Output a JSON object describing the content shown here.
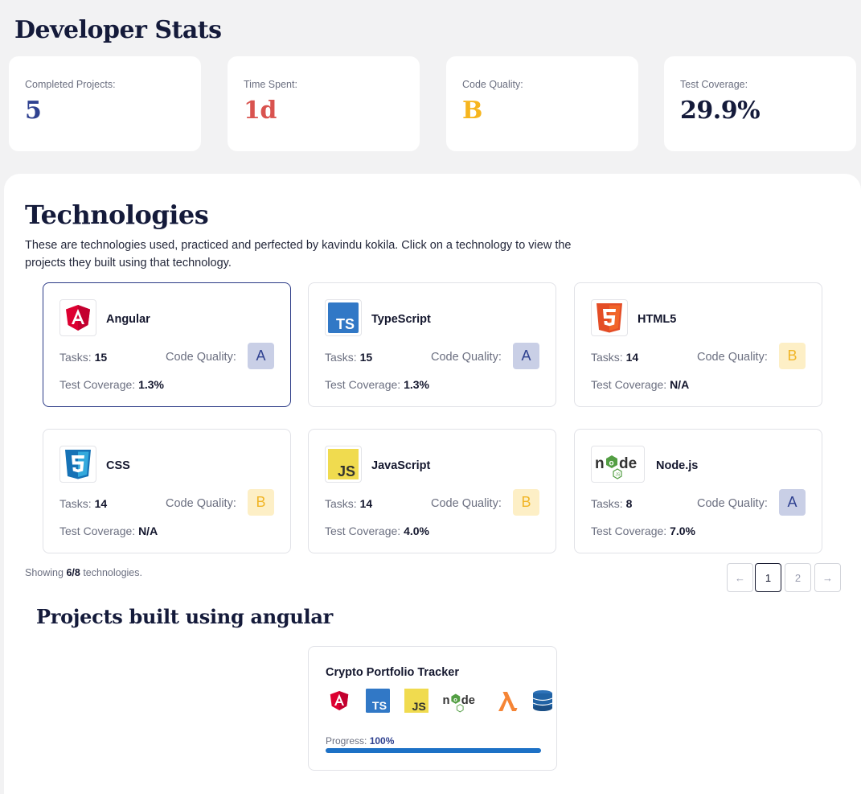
{
  "page_title": "Developer Stats",
  "stats": [
    {
      "label": "Completed Projects:",
      "value": "5",
      "color": "#2f4190"
    },
    {
      "label": "Time Spent:",
      "value": "1d",
      "color": "#d9534f"
    },
    {
      "label": "Code Quality:",
      "value": "B",
      "color": "#f6b51e"
    },
    {
      "label": "Test Coverage:",
      "value": "29.9%",
      "color": "#141a3a"
    }
  ],
  "technologies": {
    "title": "Technologies",
    "description": "These are technologies used, practiced and perfected by kavindu kokila. Click on a technology to view the projects they built using that technology.",
    "tasks_label": "Tasks:",
    "code_quality_label": "Code Quality:",
    "test_coverage_label": "Test Coverage:",
    "items": [
      {
        "name": "Angular",
        "icon": "angular-icon",
        "tasks": "15",
        "grade": "A",
        "coverage": "1.3%",
        "selected": true
      },
      {
        "name": "TypeScript",
        "icon": "typescript-icon",
        "tasks": "15",
        "grade": "A",
        "coverage": "1.3%"
      },
      {
        "name": "HTML5",
        "icon": "html5-icon",
        "tasks": "14",
        "grade": "B",
        "coverage": "N/A"
      },
      {
        "name": "CSS",
        "icon": "css3-icon",
        "tasks": "14",
        "grade": "B",
        "coverage": "N/A"
      },
      {
        "name": "JavaScript",
        "icon": "javascript-icon",
        "tasks": "14",
        "grade": "B",
        "coverage": "4.0%"
      },
      {
        "name": "Node.js",
        "icon": "nodejs-icon",
        "tasks": "8",
        "grade": "A",
        "coverage": "7.0%"
      }
    ]
  },
  "showing": {
    "prefix": "Showing",
    "count": "6/8",
    "suffix": "technologies."
  },
  "pagination": {
    "prev": "←",
    "pages": [
      "1",
      "2"
    ],
    "current": "1",
    "next": "→"
  },
  "projects": {
    "title": "Projects built using angular",
    "items": [
      {
        "name": "Crypto Portfolio Tracker",
        "icons": [
          "angular-icon",
          "typescript-icon",
          "javascript-icon",
          "nodejs-icon",
          "aws-lambda-icon",
          "dynamodb-icon"
        ],
        "progress_label": "Progress:",
        "progress_text": "100%",
        "progress": 1.0
      }
    ]
  }
}
